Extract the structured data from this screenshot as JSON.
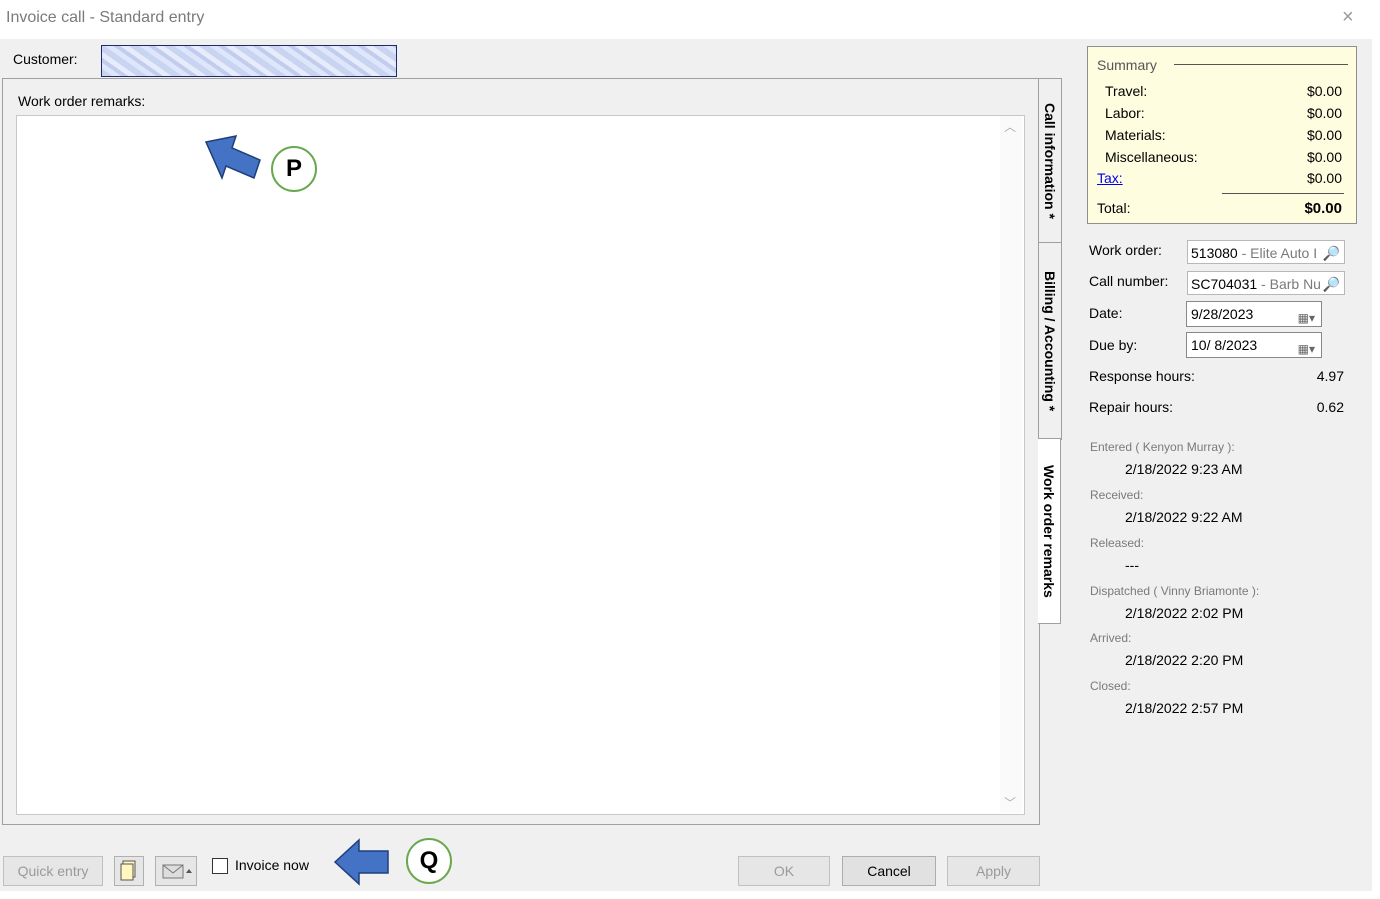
{
  "window": {
    "title": "Invoice call - Standard entry",
    "close_icon": "×"
  },
  "customer": {
    "label": "Customer:"
  },
  "work_order_remarks": {
    "label": "Work order remarks:",
    "value": ""
  },
  "tabs": [
    {
      "label": "Call information  *"
    },
    {
      "label": "Billing / Accounting  *"
    },
    {
      "label": "Work order remarks"
    }
  ],
  "summary": {
    "title": "Summary",
    "rows": [
      {
        "label": "Travel:",
        "value": "$0.00"
      },
      {
        "label": "Labor:",
        "value": "$0.00"
      },
      {
        "label": "Materials:",
        "value": "$0.00"
      },
      {
        "label": "Miscellaneous:",
        "value": "$0.00"
      }
    ],
    "tax_label": "Tax:",
    "tax_value": "$0.00",
    "total_label": "Total:",
    "total_value": "$0.00"
  },
  "details": {
    "work_order_label": "Work order:",
    "work_order_number": "513080",
    "work_order_name": " - Elite Auto I",
    "call_number_label": "Call number:",
    "call_number": "SC704031",
    "call_name": " - Barb Nu",
    "date_label": "Date:",
    "date_value": "9/28/2023",
    "due_by_label": "Due by:",
    "due_by_value": "10/  8/2023",
    "response_hours_label": "Response hours:",
    "response_hours_value": "4.97",
    "repair_hours_label": "Repair hours:",
    "repair_hours_value": "0.62"
  },
  "timestamps": [
    {
      "label": "Entered ( Kenyon Murray ):",
      "value": "2/18/2022 9:23 AM"
    },
    {
      "label": "Received:",
      "value": "2/18/2022 9:22 AM"
    },
    {
      "label": "Released:",
      "value": "---"
    },
    {
      "label": "Dispatched ( Vinny Briamonte ):",
      "value": "2/18/2022 2:02 PM"
    },
    {
      "label": "Arrived:",
      "value": "2/18/2022 2:20 PM"
    },
    {
      "label": "Closed:",
      "value": "2/18/2022 2:57 PM"
    }
  ],
  "footer": {
    "quick_entry": "Quick entry",
    "invoice_now": "Invoice now",
    "ok": "OK",
    "cancel": "Cancel",
    "apply": "Apply"
  },
  "annotations": {
    "p": "P",
    "q": "Q"
  },
  "colors": {
    "summary_bg": "#fffde0",
    "arrow": "#4472c4",
    "badge_border": "#6aa84f",
    "link": "#0000ee"
  },
  "icons": [
    "close-icon",
    "magnifier-icon",
    "calendar-icon",
    "dropdown-arrow-icon",
    "document-icon",
    "email-icon"
  ]
}
